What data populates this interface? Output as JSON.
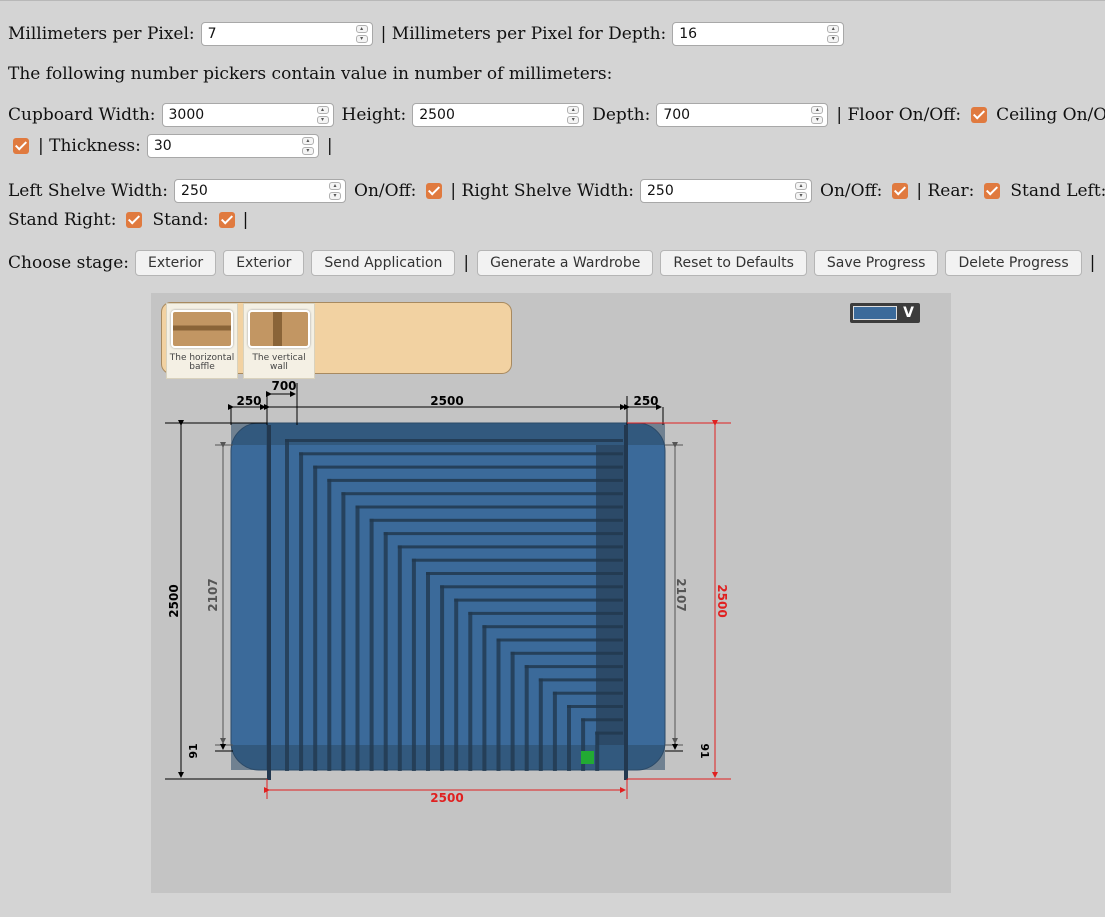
{
  "row1": {
    "mm_per_pixel_label": "Millimeters per Pixel:",
    "mm_per_pixel_value": "7",
    "mm_per_pixel_depth_label": "| Millimeters per Pixel for Depth:",
    "mm_per_pixel_depth_value": "16"
  },
  "info_text": "The following number pickers contain value in number of millimeters:",
  "cupboard": {
    "width_label": "Cupboard Width:",
    "width_value": "3000",
    "height_label": "Height:",
    "height_value": "2500",
    "depth_label": "Depth:",
    "depth_value": "700",
    "floor_label": "| Floor On/Off:",
    "ceiling_label": "Ceiling On/Off:",
    "thickness_label": "| Thickness:",
    "thickness_value": "30",
    "separator": "|"
  },
  "shelves": {
    "left_width_label": "Left Shelve Width:",
    "left_width_value": "250",
    "left_onoff_label": "On/Off:",
    "right_width_label": "| Right Shelve Width:",
    "right_width_value": "250",
    "right_onoff_label": "On/Off:",
    "rear_label": "| Rear:",
    "stand_left_label": "Stand Left:",
    "stand_right_label": "Stand Right:",
    "stand_label": "Stand:",
    "separator": "|"
  },
  "stage": {
    "label": "Choose stage:",
    "buttons": [
      "Exterior",
      "Exterior",
      "Send Application",
      "Generate a Wardrobe",
      "Reset to Defaults",
      "Save Progress",
      "Delete Progress"
    ],
    "separator": "|"
  },
  "palette": {
    "tools": [
      {
        "label_line1": "The horizontal",
        "label_line2": "baffle"
      },
      {
        "label_line1": "The vertical",
        "label_line2": "wall"
      }
    ]
  },
  "color_picker": {
    "selected_color": "#3b6a9a",
    "arrow": "V"
  },
  "dimensions": {
    "top_left_shelf": "250",
    "top_depth": "700",
    "top_main": "2500",
    "top_right_shelf": "250",
    "left_total_height": "2500",
    "left_inner_height": "2107",
    "left_bottom": "91",
    "right_inner_height": "2107",
    "right_bottom": "91",
    "right_total_height": "2500",
    "bottom_width": "2500"
  },
  "colors": {
    "cabinet": "#3b6a9a",
    "cabinet_dark": "#2c4a68",
    "accent_red": "#e02020",
    "checkbox": "#e07a3f",
    "green_marker": "#22aa33"
  }
}
